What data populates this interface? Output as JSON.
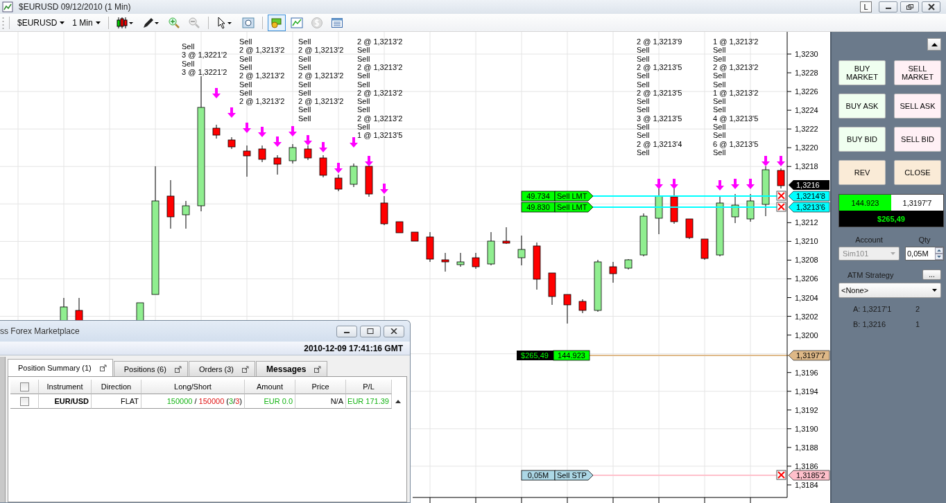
{
  "window": {
    "title": "$EURUSD  09/12/2010 (1 Min)",
    "link_button": "L"
  },
  "toolbar": {
    "instrument": "$EURUSD",
    "interval": "1 Min"
  },
  "chart": {
    "price_ticks": [
      "1,3230",
      "1,3228",
      "1,3226",
      "1,3224",
      "1,3222",
      "1,3220",
      "1,3218",
      "1,3212",
      "1,3210",
      "1,3208",
      "1,3206",
      "1,3204",
      "1,3202",
      "1,3200",
      "1,3196",
      "1,3194",
      "1,3192",
      "1,3190",
      "1,3188",
      "1,3186",
      "1,3184"
    ],
    "last_price": "1,3216",
    "execution_columns": [
      [
        "Sell",
        "3 @ 1,3221'2",
        "Sell",
        "3 @ 1,3221'2"
      ],
      [
        "Sell",
        "2 @ 1,3213'2",
        "Sell",
        "Sell",
        "2 @ 1,3213'2",
        "Sell",
        "Sell",
        "2 @ 1,3213'2"
      ],
      [
        "Sell",
        "2 @ 1,3213'2",
        "Sell",
        "Sell",
        "2 @ 1,3213'2",
        "Sell",
        "Sell",
        "2 @ 1,3213'2",
        "Sell",
        "Sell"
      ],
      [
        "2 @ 1,3213'2",
        "Sell",
        "Sell",
        "2 @ 1,3213'2",
        "Sell",
        "Sell",
        "2 @ 1,3213'2",
        "Sell",
        "Sell",
        "2 @ 1,3213'2",
        "Sell",
        "1 @ 1,3213'5"
      ],
      [
        "2 @ 1,3213'9",
        "Sell",
        "Sell",
        "2 @ 1,3213'5",
        "Sell",
        "Sell",
        "2 @ 1,3213'5",
        "Sell",
        "Sell",
        "3 @ 1,3213'5",
        "Sell",
        "Sell",
        "2 @ 1,3213'4",
        "Sell"
      ],
      [
        "1 @ 1,3213'2",
        "Sell",
        "Sell",
        "2 @ 1,3213'2",
        "Sell",
        "Sell",
        "1 @ 1,3213'2",
        "Sell",
        "Sell",
        "4 @ 1,3213'5",
        "Sell",
        "Sell",
        "6 @ 1,3213'5",
        "Sell"
      ]
    ],
    "orders": [
      {
        "kind": "limit",
        "quantity": "49.734",
        "type": "Sell LMT",
        "price": "1,3214'8"
      },
      {
        "kind": "limit",
        "quantity": "49.830",
        "type": "Sell LMT",
        "price": "1,3213'6"
      },
      {
        "kind": "stop",
        "quantity": "0,05M",
        "type": "Sell STP",
        "price": "1,3185'2"
      }
    ],
    "position": {
      "pnl": "$265,49",
      "quantity": "144.923",
      "price": "1,3197'7"
    }
  },
  "chart_trader": {
    "buttons": [
      {
        "label": "BUY MARKET",
        "kind": "buy"
      },
      {
        "label": "SELL MARKET",
        "kind": "sell"
      },
      {
        "label": "BUY ASK",
        "kind": "buy"
      },
      {
        "label": "SELL ASK",
        "kind": "sell"
      },
      {
        "label": "BUY BID",
        "kind": "buy"
      },
      {
        "label": "SELL BID",
        "kind": "sell"
      },
      {
        "label": "REV",
        "kind": "neutral"
      },
      {
        "label": "CLOSE",
        "kind": "neutral"
      }
    ],
    "position_quantity": "144.923",
    "position_price": "1,3197'7",
    "pnl": "$265,49",
    "account": {
      "label": "Account",
      "value": "Sim101",
      "disabled": true
    },
    "qty": {
      "label": "Qty",
      "value": "0,05M"
    },
    "atm": {
      "label": "ATM Strategy",
      "button": "...",
      "value": "<None>"
    },
    "quotes": [
      {
        "label": "A: 1,3217'1",
        "size": "2"
      },
      {
        "label": "B: 1,3216",
        "size": "1"
      }
    ]
  },
  "control_center": {
    "title": "ss Forex Marketplace",
    "timestamp": "2010-12-09 17:41:16 GMT",
    "tabs": [
      {
        "label": "Position Summary (1)",
        "selected": true,
        "emphasized": false
      },
      {
        "label": "Positions (6)",
        "selected": false,
        "emphasized": false
      },
      {
        "label": "Orders (3)",
        "selected": false,
        "emphasized": false
      },
      {
        "label": "Messages",
        "selected": false,
        "emphasized": true
      }
    ],
    "header_checked": false,
    "columns": [
      "Instrument",
      "Direction",
      "Long/Short",
      "Amount",
      "Price",
      "P/L"
    ],
    "rows": [
      {
        "checked": false,
        "instrument": "EUR/USD",
        "direction": "FLAT",
        "long_short": {
          "long": "150000",
          "separator": " / ",
          "short": "150000",
          "count_open": " (",
          "long_count": "3",
          "count_separator": "/",
          "short_count": "3",
          "count_close": ")"
        },
        "amount": "EUR 0.0",
        "price": "N/A",
        "pl": "EUR 171.39"
      }
    ]
  }
}
